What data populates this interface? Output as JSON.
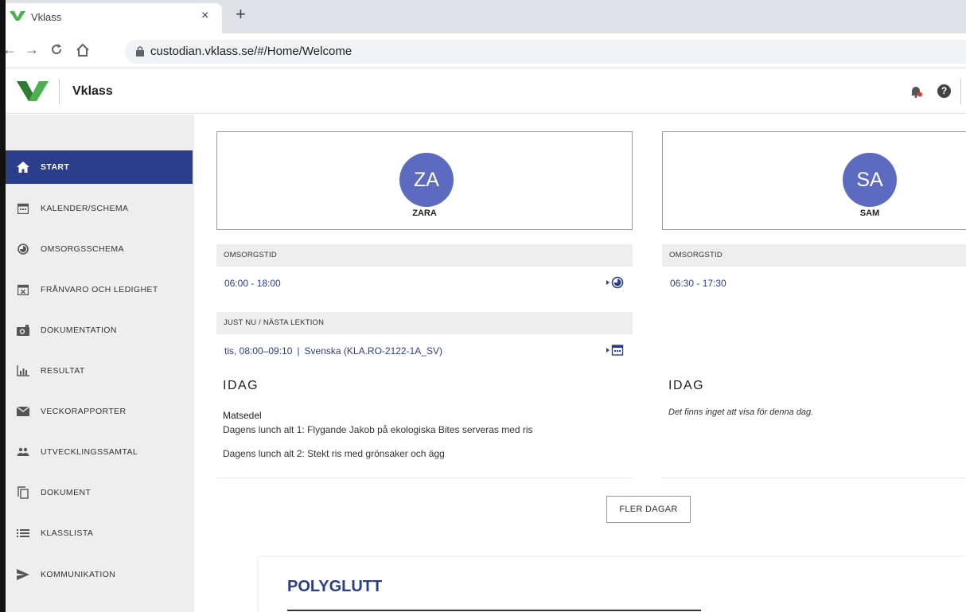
{
  "browser": {
    "tab_title": "Vklass",
    "tab_close": "×",
    "new_tab": "+",
    "url": "custodian.vklass.se/#/Home/Welcome"
  },
  "app": {
    "title": "Vklass",
    "brand_color": "#2b3e8c",
    "logo_color": "#4caf50"
  },
  "sidebar": {
    "items": [
      {
        "label": "START",
        "icon": "home-icon",
        "active": true
      },
      {
        "label": "KALENDER/SCHEMA",
        "icon": "calendar-icon"
      },
      {
        "label": "OMSORGSSCHEMA",
        "icon": "clock-half-icon"
      },
      {
        "label": "FRÅNVARO OCH LEDIGHET",
        "icon": "calendar-x-icon"
      },
      {
        "label": "DOKUMENTATION",
        "icon": "camera-icon"
      },
      {
        "label": "RESULTAT",
        "icon": "bar-chart-icon"
      },
      {
        "label": "VECKORAPPORTER",
        "icon": "envelope-icon"
      },
      {
        "label": "UTVECKLINGSSAMTAL",
        "icon": "people-icon"
      },
      {
        "label": "DOKUMENT",
        "icon": "copy-icon"
      },
      {
        "label": "KLASSLISTA",
        "icon": "list-icon"
      },
      {
        "label": "KOMMUNIKATION",
        "icon": "send-icon"
      }
    ]
  },
  "children": [
    {
      "initials": "ZA",
      "name": "ZARA",
      "care_label": "OMSORGSTID",
      "care_time": "06:00 - 18:00",
      "lesson_label": "JUST NU / NÄSTA LEKTION",
      "lesson_time": "tis, 08:00–09:10",
      "lesson_sep": "|",
      "lesson_name": "Svenska (KLA.RO-2122-1A_SV)",
      "today_label": "IDAG",
      "menu_title": "Matsedel",
      "menu_lines": [
        "Dagens lunch alt 1: Flygande Jakob på ekologiska Bites serveras med ris",
        "Dagens lunch alt 2: Stekt ris med grönsaker och ägg"
      ]
    },
    {
      "initials": "SA",
      "name": "SAM",
      "care_label": "OMSORGSTID",
      "care_time": "06:30 - 17:30",
      "today_label": "IDAG",
      "empty_note": "Det finns inget att visa för denna dag."
    }
  ],
  "more_days": "FLER DAGAR",
  "poly": {
    "title": "POLYGLUTT"
  }
}
